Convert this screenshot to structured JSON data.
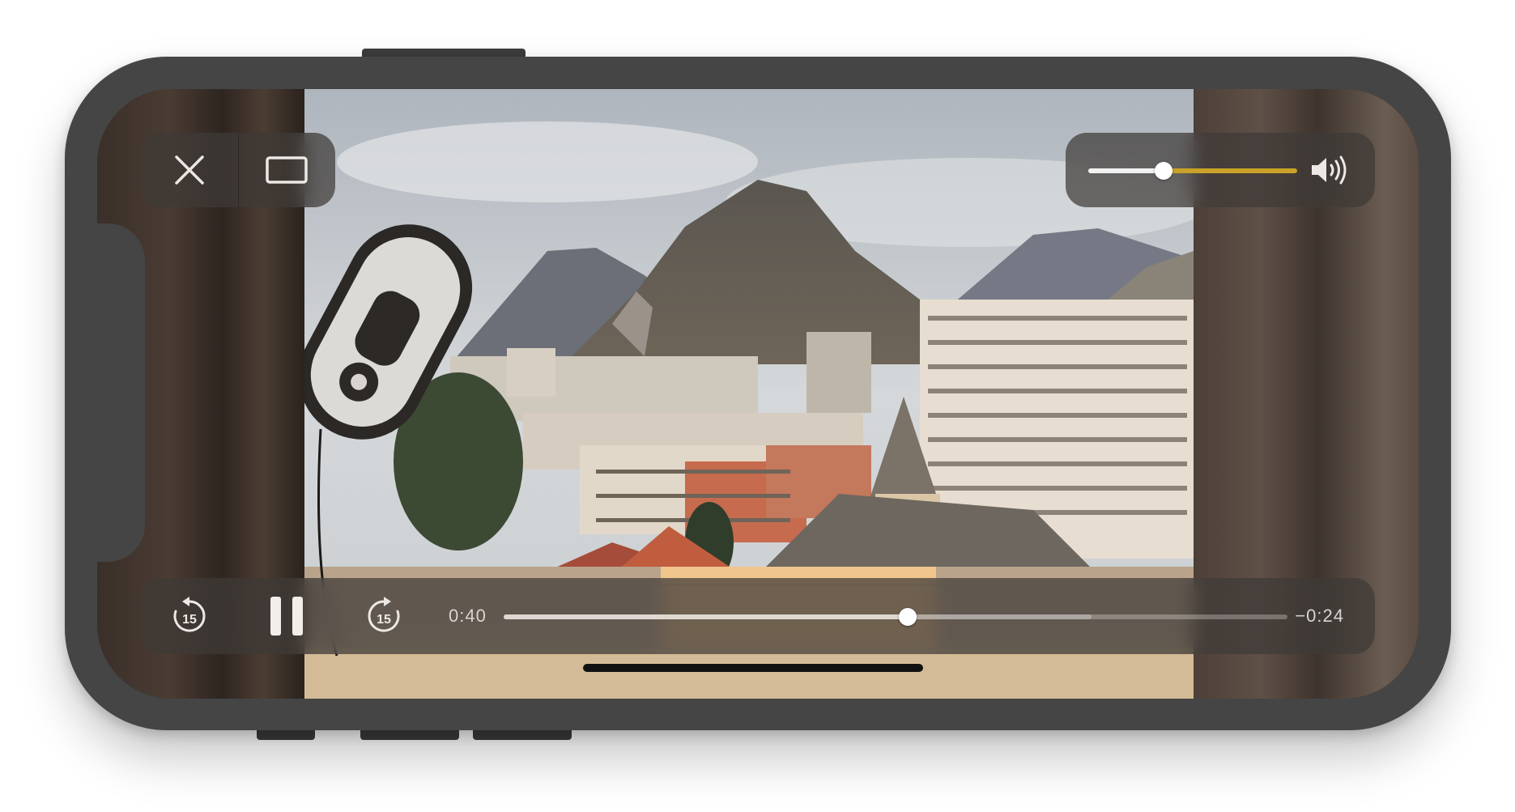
{
  "player": {
    "elapsed": "0:40",
    "remaining": "−0:24",
    "progress": 0.515,
    "buffered": 0.75,
    "volume": 0.36,
    "skip_back_seconds": "15",
    "skip_forward_seconds": "15",
    "state": "playing"
  },
  "icons": {
    "close": "close-icon",
    "fullscreen": "fullscreen-icon",
    "speaker": "speaker-icon",
    "skip_back": "skip-back-15-icon",
    "pause": "pause-icon",
    "skip_forward": "skip-forward-15-icon"
  },
  "colors": {
    "volume_fill": "#f2f2f2",
    "volume_track": "#c9a227",
    "controls_panel": "#3e3a37",
    "device_body": "#454545"
  }
}
